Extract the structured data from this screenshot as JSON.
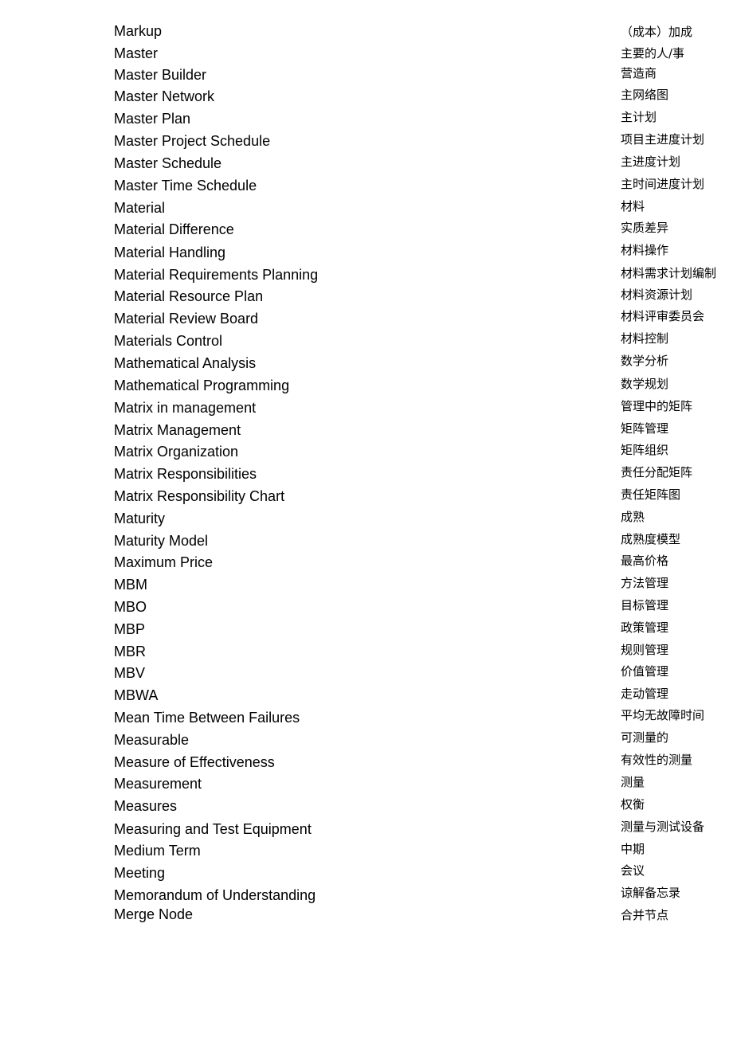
{
  "glossary": [
    {
      "en": "Markup",
      "zh": "（成本）加成"
    },
    {
      "en": "Master",
      "zh": "主要的人/事"
    },
    {
      "en": "Master Builder",
      "zh": "营造商"
    },
    {
      "en": "Master Network",
      "zh": "主网络图"
    },
    {
      "en": "Master Plan",
      "zh": "主计划"
    },
    {
      "en": "Master Project Schedule",
      "zh": "项目主进度计划"
    },
    {
      "en": "Master Schedule",
      "zh": "主进度计划"
    },
    {
      "en": "Master Time Schedule",
      "zh": "主时间进度计划"
    },
    {
      "en": "Material",
      "zh": "材料"
    },
    {
      "en": "Material Difference",
      "zh": "实质差异"
    },
    {
      "en": "Material Handling",
      "zh": "材料操作"
    },
    {
      "en": "Material Requirements Planning",
      "zh": "材料需求计划编制"
    },
    {
      "en": "Material Resource Plan",
      "zh": "材料资源计划"
    },
    {
      "en": "Material Review Board",
      "zh": "材料评审委员会"
    },
    {
      "en": "Materials Control",
      "zh": "材料控制"
    },
    {
      "en": "Mathematical Analysis",
      "zh": "数学分析"
    },
    {
      "en": "Mathematical Programming",
      "zh": "数学规划"
    },
    {
      "en": "Matrix in management",
      "zh": "管理中的矩阵"
    },
    {
      "en": "Matrix Management",
      "zh": "矩阵管理"
    },
    {
      "en": "Matrix Organization",
      "zh": "矩阵组织"
    },
    {
      "en": "Matrix Responsibilities",
      "zh": "责任分配矩阵"
    },
    {
      "en": "Matrix Responsibility Chart",
      "zh": "责任矩阵图"
    },
    {
      "en": "Maturity",
      "zh": "成熟"
    },
    {
      "en": "Maturity Model",
      "zh": "成熟度模型"
    },
    {
      "en": "Maximum Price",
      "zh": "最高价格"
    },
    {
      "en": "MBM",
      "zh": "方法管理"
    },
    {
      "en": "MBO",
      "zh": "目标管理"
    },
    {
      "en": "MBP",
      "zh": "政策管理"
    },
    {
      "en": "MBR",
      "zh": "规则管理"
    },
    {
      "en": "MBV",
      "zh": "价值管理"
    },
    {
      "en": "MBWA",
      "zh": "走动管理"
    },
    {
      "en": "Mean Time Between Failures",
      "zh": "平均无故障时间"
    },
    {
      "en": "Measurable",
      "zh": "可测量的"
    },
    {
      "en": "Measure of Effectiveness",
      "zh": "有效性的测量"
    },
    {
      "en": "Measurement",
      "zh": "测量"
    },
    {
      "en": "Measures",
      "zh": "权衡"
    },
    {
      "en": "Measuring and Test Equipment",
      "zh": "测量与测试设备"
    },
    {
      "en": "Medium Term",
      "zh": "中期"
    },
    {
      "en": "Meeting",
      "zh": "会议"
    },
    {
      "en": "Memorandum of Understanding",
      "zh": "谅解备忘录"
    },
    {
      "en": "Merge Node",
      "zh": "合并节点"
    }
  ]
}
